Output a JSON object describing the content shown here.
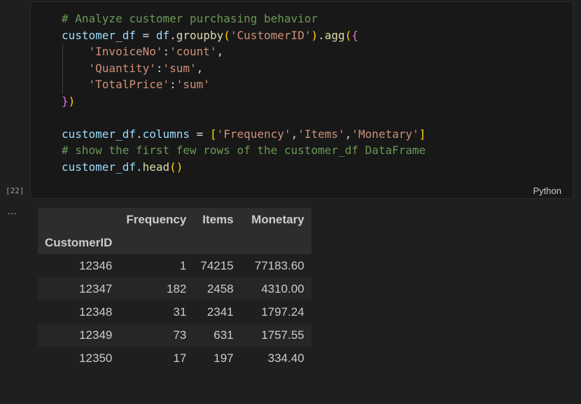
{
  "cell": {
    "execution_count": "[22]",
    "language": "Python",
    "code": {
      "comment1": "# Analyze customer purchasing behavior",
      "assign_var": "customer_df",
      "assign_op": " = ",
      "df": "df",
      "dot1": ".",
      "groupby": "groupby",
      "lp1": "(",
      "groupby_arg": "'CustomerID'",
      "rp1": ")",
      "dot2": ".",
      "agg": "agg",
      "lp2": "(",
      "lb": "{",
      "k1": "'InvoiceNo'",
      "colon1": ":",
      "v1": "'count'",
      "comma1": ",",
      "k2": "'Quantity'",
      "colon2": ":",
      "v2": "'sum'",
      "comma2": ",",
      "k3": "'TotalPrice'",
      "colon3": ":",
      "v3": "'sum'",
      "rb": "}",
      "rp2": ")",
      "cols_var": "customer_df",
      "cols_dot": ".",
      "cols_attr": "columns",
      "cols_eq": " = ",
      "lsb": "[",
      "c1": "'Frequency'",
      "cc1": ",",
      "c2": "'Items'",
      "cc2": ",",
      "c3": "'Monetary'",
      "rsb": "]",
      "comment2": "# show the first few rows of the customer_df DataFrame",
      "head_var": "customer_df",
      "head_dot": ".",
      "head_fn": "head",
      "head_lp": "(",
      "head_rp": ")"
    }
  },
  "output": {
    "ellipsis": "…",
    "table": {
      "columns": [
        "Frequency",
        "Items",
        "Monetary"
      ],
      "index_name": "CustomerID",
      "rows": [
        {
          "id": "12346",
          "frequency": "1",
          "items": "74215",
          "monetary": "77183.60"
        },
        {
          "id": "12347",
          "frequency": "182",
          "items": "2458",
          "monetary": "4310.00"
        },
        {
          "id": "12348",
          "frequency": "31",
          "items": "2341",
          "monetary": "1797.24"
        },
        {
          "id": "12349",
          "frequency": "73",
          "items": "631",
          "monetary": "1757.55"
        },
        {
          "id": "12350",
          "frequency": "17",
          "items": "197",
          "monetary": "334.40"
        }
      ]
    }
  }
}
